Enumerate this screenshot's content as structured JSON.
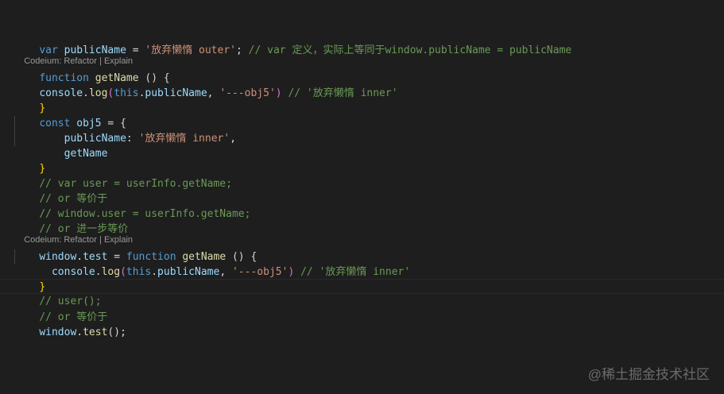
{
  "code": {
    "l1": {
      "kw": "var",
      "name": " publicName ",
      "eq": "= ",
      "str": "'放弃懒惰 outer'",
      "semi": "; ",
      "comment": "// var 定义，实际上等同于window.publicName = publicName"
    },
    "lens1": {
      "refactor": "Codeium: Refactor",
      "sep": " | ",
      "explain": "Explain"
    },
    "l2": {
      "kw": "function",
      "sp": " ",
      "fn": "getName",
      "rest": " () {"
    },
    "l3": {
      "obj": "console",
      "dot": ".",
      "fn": "log",
      "open": "(",
      "kw": "this",
      "dot2": ".",
      "prop": "publicName",
      "comma": ", ",
      "str": "'---obj5'",
      "close": ")",
      "sp": " ",
      "comment": "// '放弃懒惰 inner'"
    },
    "l4": {
      "brace": "}"
    },
    "l5": {
      "kw": "const",
      "sp": " ",
      "name": "obj5",
      "rest": " = {"
    },
    "l6": {
      "indent": "    ",
      "prop": "publicName",
      "colon": ": ",
      "str": "'放弃懒惰 inner'",
      "comma": ","
    },
    "l7": {
      "indent": "    ",
      "prop": "getName"
    },
    "l8": {
      "brace": "}"
    },
    "l9": {
      "comment": "// var user = userInfo.getName;"
    },
    "l10": {
      "comment": "// or 等价于"
    },
    "l11": {
      "comment": "// window.user = userInfo.getName;"
    },
    "l12": {
      "comment": "// or 进一步等价"
    },
    "lens2": {
      "refactor": "Codeium: Refactor",
      "sep": " | ",
      "explain": "Explain"
    },
    "l13": {
      "obj": "window",
      "dot": ".",
      "prop": "test",
      "eq": " = ",
      "kw": "function",
      "sp": " ",
      "fn": "getName",
      "rest": " () {"
    },
    "l14": {
      "indent": "  ",
      "obj": "console",
      "dot": ".",
      "fn": "log",
      "open": "(",
      "kw": "this",
      "dot2": ".",
      "prop": "publicName",
      "comma": ", ",
      "str": "'---obj5'",
      "close": ")",
      "sp": " ",
      "comment": "// '放弃懒惰 inner'"
    },
    "l15": {
      "brace": "}"
    },
    "l16": {
      "comment": "// user();"
    },
    "l17": {
      "comment": "// or 等价于"
    },
    "l18": {
      "obj": "window",
      "dot": ".",
      "fn": "test",
      "rest": "();"
    }
  },
  "watermark": "@稀土掘金技术社区",
  "colors": {
    "background": "#1e1e1e",
    "keyword": "#569cd6",
    "variable": "#9cdcfe",
    "function": "#dcdcaa",
    "string": "#ce9178",
    "comment": "#6a9955",
    "bracket_gold": "#ffd700",
    "bracket_purple": "#da70d6",
    "lens_text": "#999999"
  }
}
